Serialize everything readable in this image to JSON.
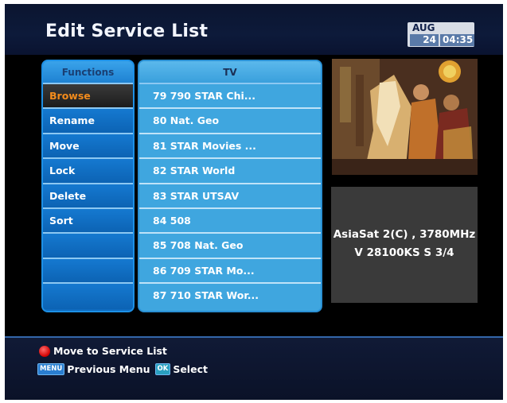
{
  "header": {
    "title": "Edit Service List",
    "clock": {
      "month": "AUG",
      "day": "24",
      "time": "04:35"
    }
  },
  "functions": {
    "header": "Functions",
    "items": [
      "Browse",
      "Rename",
      "Move",
      "Lock",
      "Delete",
      "Sort",
      "",
      "",
      ""
    ],
    "selected_index": 0
  },
  "services": {
    "header": "TV",
    "items": [
      "79  790 STAR Chi...",
      "80  Nat. Geo",
      "81  STAR Movies ...",
      "82  STAR World",
      "83  STAR UTSAV",
      "84  508",
      "85  708 Nat. Geo",
      "86  709 STAR Mo...",
      "87  710 STAR Wor..."
    ]
  },
  "info": {
    "line1": "AsiaSat 2(C) , 3780MHz",
    "line2": "V 28100KS S 3/4"
  },
  "footer": {
    "red_hint": "Move to Service List",
    "menu_badge": "MENU",
    "menu_hint": "Previous Menu",
    "ok_badge": "OK",
    "ok_hint": "Select"
  },
  "colors": {
    "header_bg": "#0d1a3a",
    "functions_bg": "#0f6cc0",
    "services_bg": "#3fa7e0",
    "selected_text": "#f28b1c",
    "red_key": "#d00000"
  }
}
